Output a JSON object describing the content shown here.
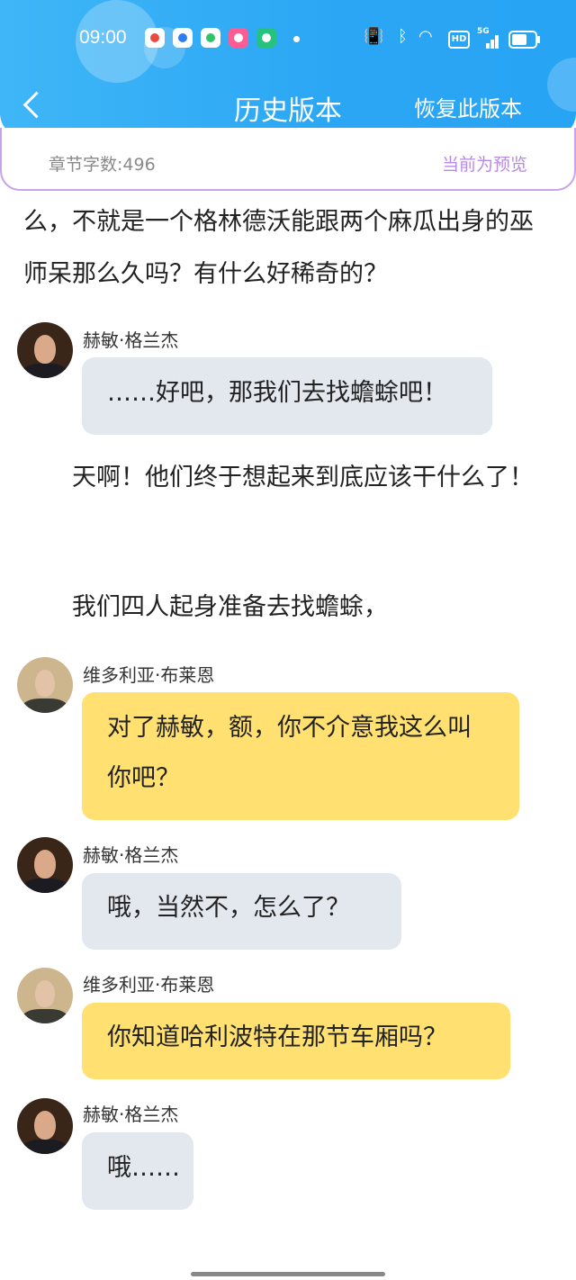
{
  "status_bar": {
    "time": "09:00",
    "network": "5G",
    "hd_badge": "HD",
    "icons": [
      "notification-app-icon",
      "blue-app-icon",
      "video-app-icon",
      "pink-app-icon",
      "green-app-icon",
      "vibrate-mute-icon",
      "bluetooth-icon",
      "wifi-icon",
      "signal-icon",
      "battery-icon"
    ]
  },
  "header": {
    "title": "历史版本",
    "restore_label": "恢复此版本",
    "back_icon": "chevron-left-icon"
  },
  "info_bar": {
    "word_count": "章节字数:496",
    "preview_label": "当前为预览"
  },
  "content": {
    "para_top": "么，不就是一个格林德沃能跟两个麻瓜出身的巫师呆那么久吗？有什么好稀奇的？",
    "para_mid1": "　　天啊！他们终于想起来到底应该干什么了！",
    "para_mid2": "　　我们四人起身准备去找蟾蜍，",
    "messages": [
      {
        "speaker": "赫敏·格兰杰",
        "text": "……好吧，那我们去找蟾蜍吧！"
      },
      {
        "speaker": "维多利亚·布莱恩",
        "text": "对了赫敏，额，你不介意我这么叫你吧？"
      },
      {
        "speaker": "赫敏·格兰杰",
        "text": "哦，当然不，怎么了？"
      },
      {
        "speaker": "维多利亚·布莱恩",
        "text": "你知道哈利波特在那节车厢吗？"
      },
      {
        "speaker": "赫敏·格兰杰",
        "text": "哦……"
      }
    ]
  },
  "colors": {
    "header_blue": "#2aa6f4",
    "preview_purple": "#b889e6",
    "bubble_grey": "#e3e7ee",
    "bubble_yellow": "#ffe070"
  }
}
